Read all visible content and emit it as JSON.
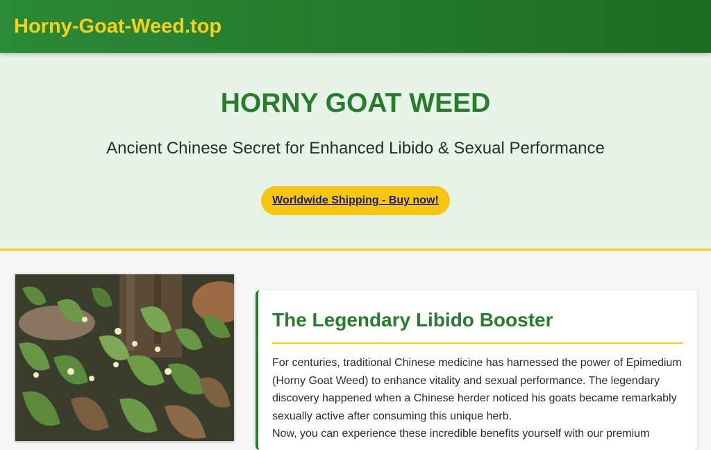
{
  "header": {
    "site_title": "Horny-Goat-Weed.top"
  },
  "hero": {
    "title": "HORNY GOAT WEED",
    "subtitle": "Ancient Chinese Secret for Enhanced Libido & Sexual Performance",
    "cta_label": "Worldwide Shipping - Buy now!"
  },
  "article": {
    "title": "The Legendary Libido Booster",
    "paragraph_1": "For centuries, traditional Chinese medicine has harnessed the power of Epimedium (Horny Goat Weed) to enhance vitality and sexual performance. The legendary discovery happened when a Chinese herder noticed his goats became remarkably sexually active after consuming this unique herb.",
    "paragraph_2": "Now, you can experience these incredible benefits yourself with our premium"
  },
  "colors": {
    "header_green": "#2b8a36",
    "accent_yellow": "#f3cf1f",
    "title_green": "#2a7a30",
    "hero_bg": "#e6f4e7",
    "cta_bg": "#f7c613"
  },
  "photo": {
    "icon": "epimedium-plant-photo"
  }
}
